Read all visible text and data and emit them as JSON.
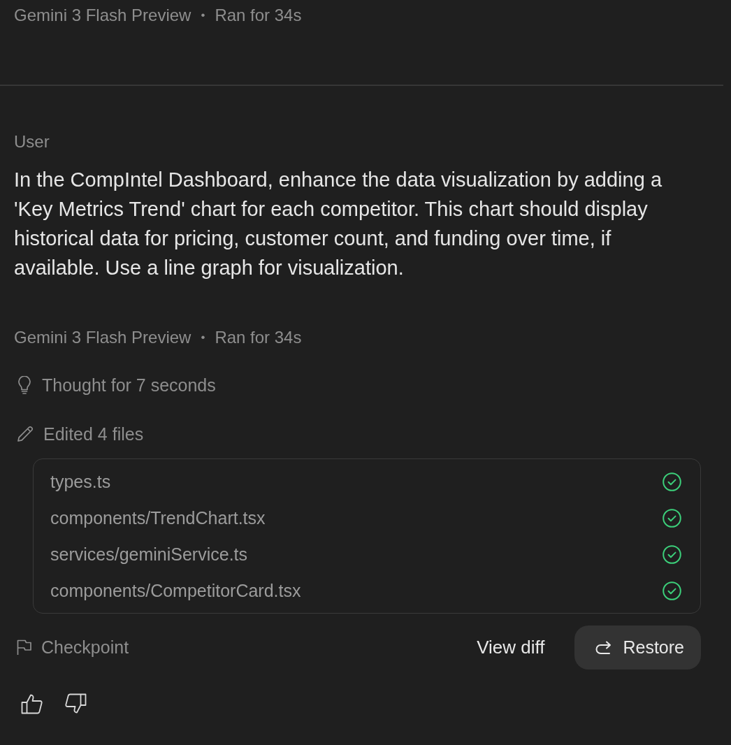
{
  "previous_turn": {
    "meta": {
      "model": "Gemini 3 Flash Preview",
      "separator": "•",
      "duration": "Ran for 34s"
    }
  },
  "user_message": {
    "role": "User",
    "text": "In the CompIntel Dashboard, enhance the data visualization by adding a 'Key Metrics Trend' chart for each competitor. This chart should display historical data for pricing, customer count, and funding over time, if available. Use a line graph for visualization."
  },
  "model_turn": {
    "meta": {
      "model": "Gemini 3 Flash Preview",
      "separator": "•",
      "duration": "Ran for 34s"
    },
    "thought": "Thought for 7 seconds",
    "edits": {
      "label": "Edited 4 files",
      "files": [
        {
          "path": "types.ts",
          "done": true
        },
        {
          "path": "components/TrendChart.tsx",
          "done": true
        },
        {
          "path": "services/geminiService.ts",
          "done": true
        },
        {
          "path": "components/CompetitorCard.tsx",
          "done": true
        }
      ]
    },
    "checkpoint": {
      "label": "Checkpoint",
      "buttons": [
        {
          "kind": "text",
          "label": "View diff"
        },
        {
          "kind": "filled",
          "label": "Restore"
        }
      ]
    }
  }
}
